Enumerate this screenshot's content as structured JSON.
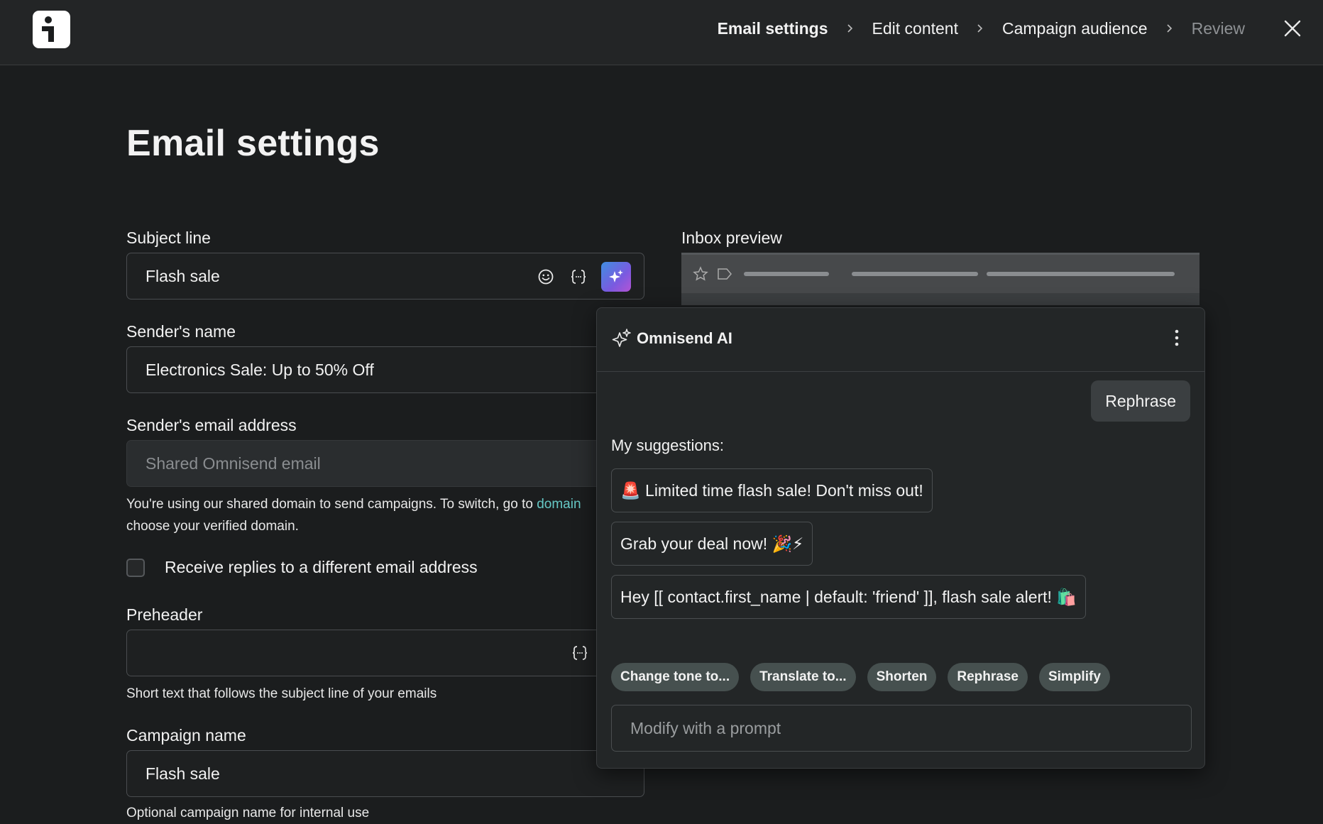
{
  "header": {
    "steps": [
      {
        "label": "Email settings",
        "state": "active"
      },
      {
        "label": "Edit content",
        "state": "normal"
      },
      {
        "label": "Campaign audience",
        "state": "normal"
      },
      {
        "label": "Review",
        "state": "dim"
      }
    ]
  },
  "page": {
    "title": "Email settings"
  },
  "form": {
    "subject": {
      "label": "Subject line",
      "value": "Flash sale"
    },
    "sender_name": {
      "label": "Sender's name",
      "value": "Electronics Sale: Up to 50% Off"
    },
    "sender_email": {
      "label": "Sender's email address",
      "value": "Shared Omnisend email",
      "helper_line1_prefix": "You're using our shared domain to send campaigns. To switch, go to ",
      "helper_link": "domain",
      "helper_line2": "choose your verified domain."
    },
    "replies_checkbox": {
      "label": "Receive replies to a different email address",
      "checked": false
    },
    "preheader": {
      "label": "Preheader",
      "value": "",
      "helper": "Short text that follows the subject line of your emails"
    },
    "campaign_name": {
      "label": "Campaign name",
      "value": "Flash sale",
      "helper": "Optional campaign name for internal use"
    }
  },
  "inbox_preview": {
    "label": "Inbox preview"
  },
  "ai_panel": {
    "title": "Omnisend AI",
    "user_message": "Rephrase",
    "suggestions_label": "My suggestions:",
    "suggestions": [
      "🚨 Limited time flash sale! Don't miss out!",
      "Grab your deal now! 🎉⚡",
      "Hey [[ contact.first_name | default: 'friend' ]], flash sale alert! 🛍️"
    ],
    "chips": [
      "Change tone to...",
      "Translate to...",
      "Shorten",
      "Rephrase",
      "Simplify"
    ],
    "prompt_placeholder": "Modify with a prompt"
  },
  "colors": {
    "background": "#1b1d1e",
    "link": "#66c9c6",
    "chip": "#46504f"
  }
}
